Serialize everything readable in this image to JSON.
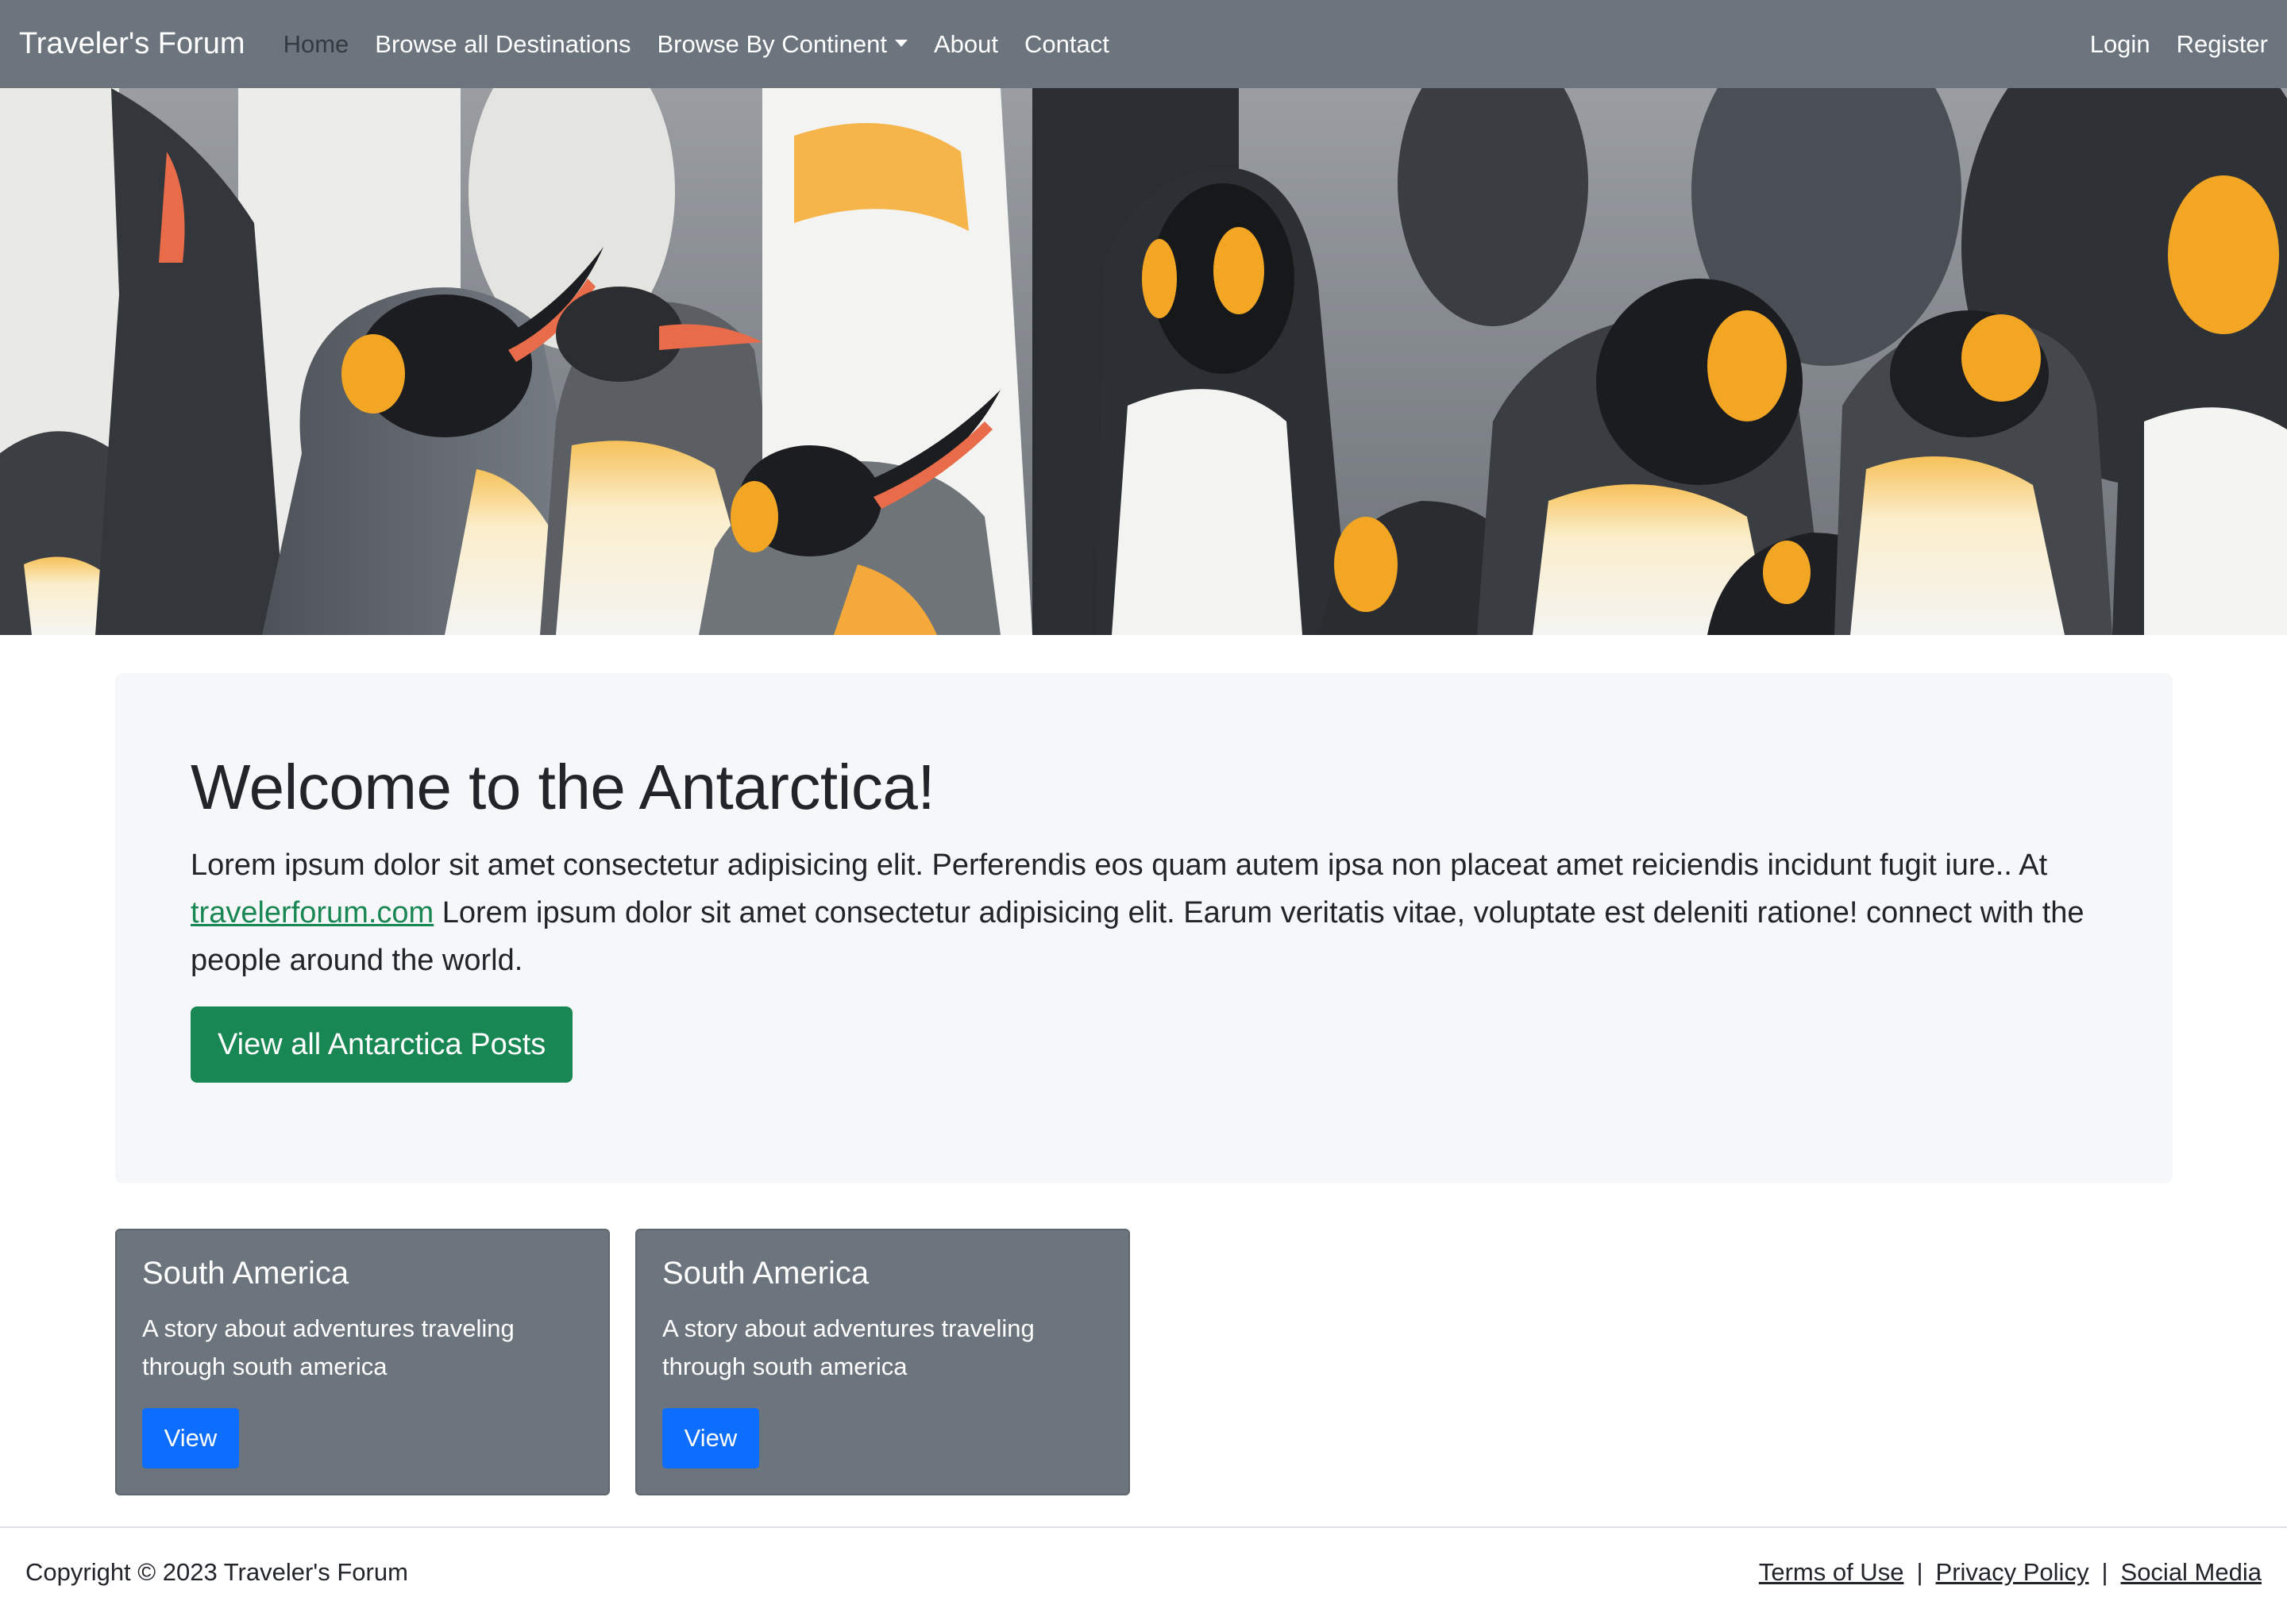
{
  "navbar": {
    "brand": "Traveler's Forum",
    "links": [
      "Home",
      "Browse all Destinations",
      "Browse By Continent",
      "About",
      "Contact"
    ],
    "auth": [
      "Login",
      "Register"
    ]
  },
  "jumbotron": {
    "title": "Welcome to the Antarctica!",
    "text_before_link": "Lorem ipsum dolor sit amet consectetur adipisicing elit. Perferendis eos quam autem ipsa non placeat amet reiciendis incidunt fugit iure.. At ",
    "link_text": "travelerforum.com",
    "text_after_link": " Lorem ipsum dolor sit amet consectetur adipisicing elit. Earum veritatis vitae, voluptate est deleniti ratione! connect with the people around the world.",
    "button_label": "View all Antarctica Posts"
  },
  "cards": [
    {
      "title": "South America",
      "text": "A story about adventures traveling through south america",
      "button_label": "View"
    },
    {
      "title": "South America",
      "text": "A story about adventures traveling through south america",
      "button_label": "View"
    }
  ],
  "footer": {
    "copyright": "Copyright © 2023 Traveler's Forum",
    "links": [
      "Terms of Use",
      "Privacy Policy",
      "Social Media"
    ],
    "separator": "|"
  },
  "colors": {
    "navbar": "#6c757d",
    "primary_button": "#0d6efd",
    "success_button": "#198754",
    "jumbotron_bg": "#f6f7f9"
  }
}
